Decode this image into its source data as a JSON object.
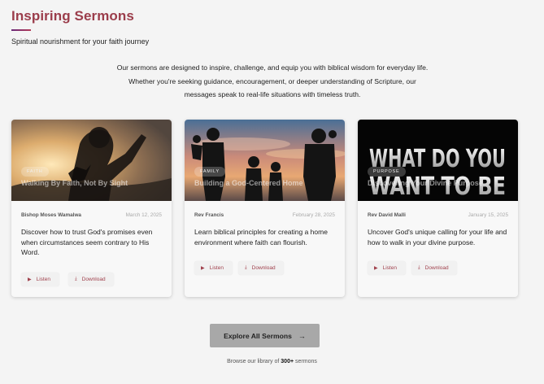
{
  "header": {
    "title": "Inspiring Sermons",
    "subtitle": "Spiritual nourishment for your faith journey"
  },
  "intro": {
    "line1": "Our sermons are designed to inspire, challenge, and equip you with biblical wisdom for everyday life.",
    "line2": "Whether you're seeking guidance, encouragement, or deeper understanding of Scripture, our",
    "line3": "messages speak to real-life situations with timeless truth."
  },
  "sermons": [
    {
      "category": "FAITH",
      "title": "Walking By Faith, Not By Sight",
      "speaker": "Bishop Moses Wamalwa",
      "date": "March 12, 2025",
      "description": "Discover how to trust God's promises even when circumstances seem contrary to His Word.",
      "listen_label": "Listen",
      "download_label": "Download"
    },
    {
      "category": "FAMILY",
      "title": "Building a God-Centered Home",
      "speaker": "Rev Francis",
      "date": "February 28, 2025",
      "description": "Learn biblical principles for creating a home environment where faith can flourish.",
      "listen_label": "Listen",
      "download_label": "Download"
    },
    {
      "category": "PURPOSE",
      "title": "Discovering Your Divine Purpose",
      "image_text_line1": "WHAT DO YOU",
      "image_text_line2": "WANT TO BE",
      "speaker": "Rev David Malli",
      "date": "January 15, 2025",
      "description": "Uncover God's unique calling for your life and how to walk in your divine purpose.",
      "listen_label": "Listen",
      "download_label": "Download"
    }
  ],
  "icons": {
    "listen": "play-icon",
    "download": "download-icon",
    "explore": "arrow-right-icon"
  },
  "footer": {
    "explore_label": "Explore All Sermons",
    "library_prefix": "Browse our library of",
    "library_count": "300+",
    "library_suffix": "sermons"
  },
  "colors": {
    "accent": "#9b3d4b",
    "button_text": "#a0404c",
    "explore_bg": "#a8a8a8"
  }
}
